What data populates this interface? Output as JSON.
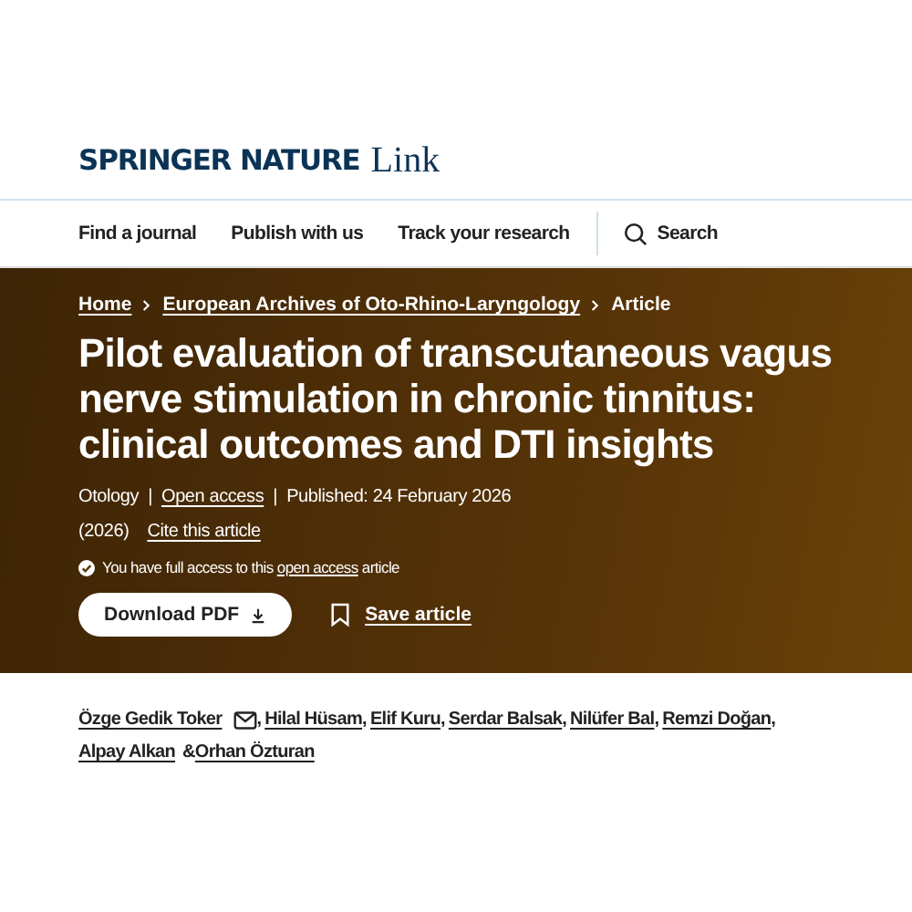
{
  "header": {
    "logo_brand": "SPRINGER NATURE",
    "logo_product": "Link"
  },
  "nav": {
    "items": [
      {
        "label": "Find a journal"
      },
      {
        "label": "Publish with us"
      },
      {
        "label": "Track your research"
      }
    ],
    "search": "Search"
  },
  "breadcrumbs": [
    {
      "label": "Home",
      "kind": "link"
    },
    {
      "label": "European Archives of Oto-Rhino-Laryngology",
      "kind": "link"
    },
    {
      "label": "Article",
      "kind": "current"
    }
  ],
  "title": "Pilot evaluation of transcutaneous vagus nerve stimulation in chronic tinnitus: clinical outcomes and DTI insights",
  "meta_lines": [
    [
      {
        "text": "Otology",
        "kind": "text"
      },
      {
        "text": "|",
        "kind": "divider"
      },
      {
        "text": "Open access",
        "kind": "link"
      },
      {
        "text": "|",
        "kind": "divider"
      },
      {
        "text": "Published: 24 February 2026",
        "kind": "text"
      }
    ],
    [
      {
        "text": "(2026)",
        "kind": "text"
      },
      {
        "text": "Cite this article",
        "kind": "link"
      }
    ]
  ],
  "access_notice": {
    "before": "You have full access to this",
    "link": "open access",
    "after": "article"
  },
  "actions": {
    "download": "Download PDF",
    "save": "Save article"
  },
  "authors": [
    {
      "name": "Özge Gedik Toker",
      "corresponding": true,
      "separator": ","
    },
    {
      "name": "Hilal Hüsam",
      "corresponding": false,
      "separator": ","
    },
    {
      "name": "Elif Kuru",
      "corresponding": false,
      "separator": ","
    },
    {
      "name": "Serdar Balsak",
      "corresponding": false,
      "separator": ","
    },
    {
      "name": "Nilüfer Bal",
      "corresponding": false,
      "separator": ","
    },
    {
      "name": "Remzi Doğan",
      "corresponding": false,
      "separator": ","
    },
    {
      "name": "Alpay Alkan",
      "corresponding": false,
      "separator": "&"
    },
    {
      "name": "Orhan Özturan",
      "corresponding": false
    }
  ]
}
